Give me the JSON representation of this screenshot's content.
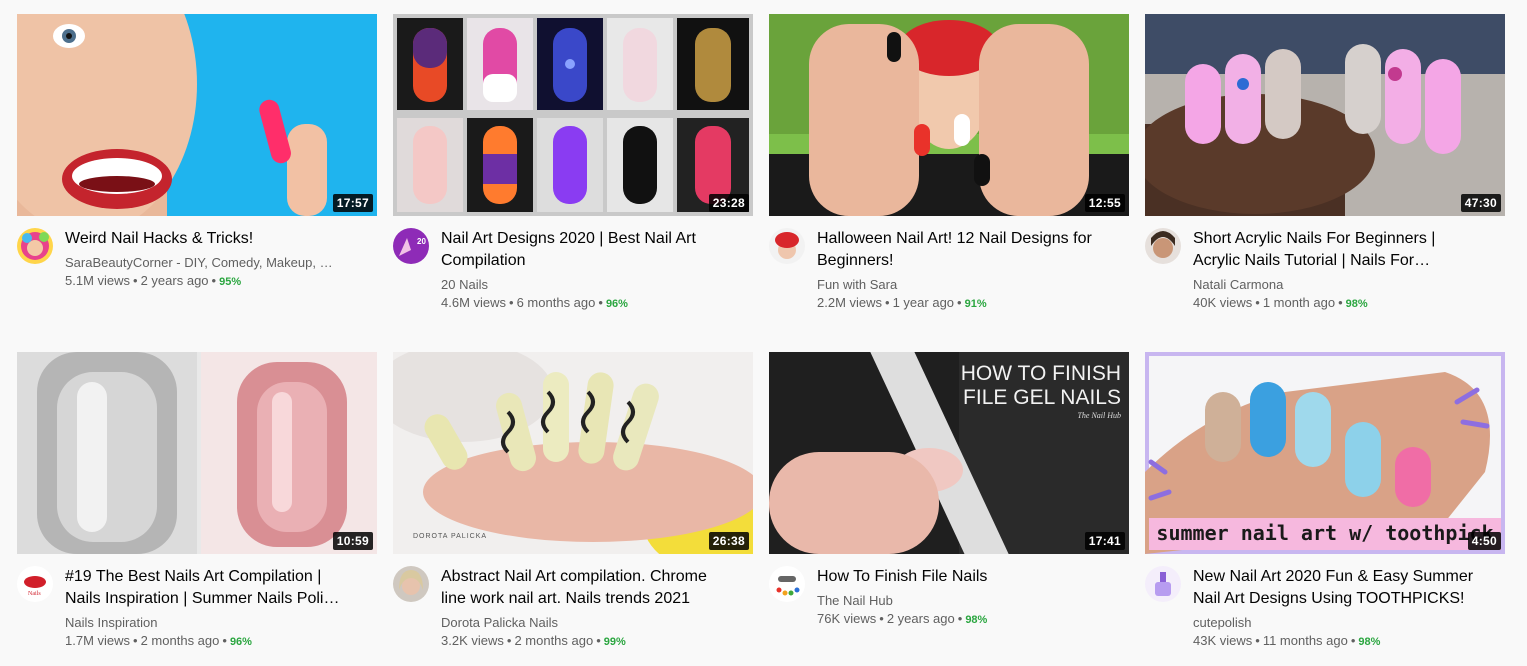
{
  "videos": [
    {
      "title": "Weird Nail Hacks & Tricks!",
      "channel": "SaraBeautyCorner - DIY, Comedy, Makeup, …",
      "views": "5.1M views",
      "age": "2 years ago",
      "rating": "95%",
      "duration": "17:57",
      "sep": "•",
      "sep2": "•"
    },
    {
      "title": "Nail Art Designs 2020 | Best Nail Art Compilation",
      "channel": "20 Nails",
      "views": "4.6M views",
      "age": "6 months ago",
      "rating": "96%",
      "duration": "23:28",
      "sep": "•",
      "sep2": "•"
    },
    {
      "title": "Halloween Nail Art! 12 Nail Designs for Beginners!",
      "channel": "Fun with Sara",
      "views": "2.2M views",
      "age": "1 year ago",
      "rating": "91%",
      "duration": "12:55",
      "sep": "•",
      "sep2": "•"
    },
    {
      "title": "Short Acrylic Nails For Beginners | Acrylic Nails Tutorial | Nails For…",
      "channel": "Natali Carmona",
      "views": "40K views",
      "age": "1 month ago",
      "rating": "98%",
      "duration": "47:30",
      "sep": "•",
      "sep2": "•"
    },
    {
      "title": "#19 The Best Nails Art Compilation | Nails Inspiration | Summer Nails Poli…",
      "channel": "Nails Inspiration",
      "views": "1.7M views",
      "age": "2 months ago",
      "rating": "96%",
      "duration": "10:59",
      "sep": "•",
      "sep2": "•"
    },
    {
      "title": "Abstract Nail Art compilation. Chrome line work nail art. Nails trends 2021",
      "channel": "Dorota Palicka Nails",
      "views": "3.2K views",
      "age": "2 months ago",
      "rating": "99%",
      "duration": "26:38",
      "sep": "•",
      "sep2": "•"
    },
    {
      "title": "How To Finish File Nails",
      "channel": "The Nail Hub",
      "views": "76K views",
      "age": "2 years ago",
      "rating": "98%",
      "duration": "17:41",
      "sep": "•",
      "sep2": "•"
    },
    {
      "title": "New Nail Art 2020 Fun & Easy Summer Nail Art Designs Using TOOTHPICKS!",
      "channel": "cutepolish",
      "views": "43K views",
      "age": "11 months ago",
      "rating": "98%",
      "duration": "4:50",
      "sep": "•",
      "sep2": "•"
    }
  ],
  "thumb_text": {
    "finish_line1": "HOW TO FINISH",
    "finish_line2": "FILE GEL NAILS",
    "finish_brand": "The Nail Hub",
    "summer_banner": "summer nail art w/ toothpick",
    "dorota_logo": "DOROTA PALICKA"
  },
  "avatar_text": {
    "twenty": "20",
    "inspo": "Nails"
  },
  "colors": {
    "rating": "#2ba640",
    "meta": "#606060",
    "title": "#030303",
    "bg": "#f9f9f9"
  }
}
